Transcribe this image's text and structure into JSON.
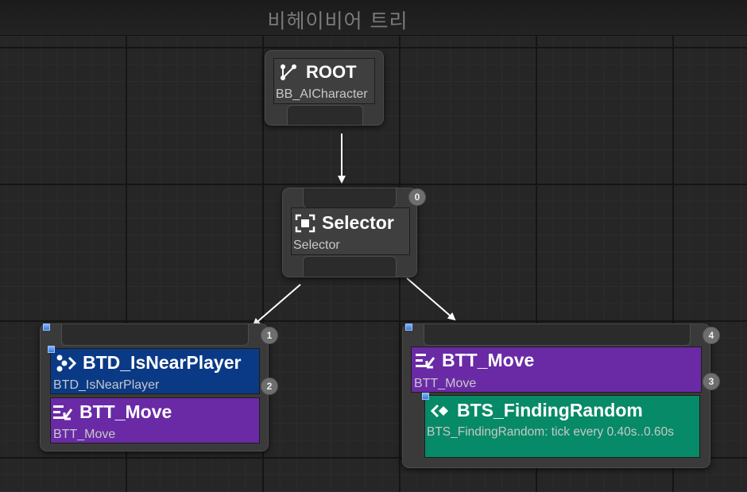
{
  "graph_title": "비헤이비어 트리",
  "root": {
    "title": "ROOT",
    "subtitle": "BB_AICharacter",
    "icon": "root-branch-icon"
  },
  "selector": {
    "title": "Selector",
    "subtitle": "Selector",
    "icon": "selector-icon",
    "index": "0"
  },
  "left_branch": {
    "index": "1",
    "decorator": {
      "title": "BTD_IsNearPlayer",
      "subtitle": "BTD_IsNearPlayer",
      "icon": "decorator-icon",
      "index": "2",
      "color": "#0a3a86"
    },
    "task": {
      "title": "BTT_Move",
      "subtitle": "BTT_Move",
      "icon": "task-icon",
      "color": "#6a2aa6"
    }
  },
  "right_branch": {
    "index": "4",
    "task": {
      "title": "BTT_Move",
      "subtitle": "BTT_Move",
      "icon": "task-icon",
      "index": "3",
      "color": "#6a2aa6"
    },
    "service": {
      "title": "BTS_FindingRandom",
      "subtitle": "BTS_FindingRandom: tick every 0.40s..0.60s",
      "icon": "service-icon",
      "color": "#078a67"
    }
  }
}
